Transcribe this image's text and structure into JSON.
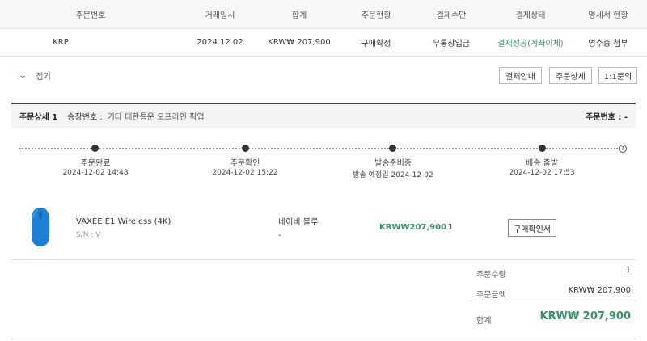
{
  "table": {
    "headers": [
      "주문번호",
      "거래일시",
      "합계",
      "주문현황",
      "결제수단",
      "결제상태",
      "명세서 현황"
    ],
    "row": {
      "order_no": "KRP",
      "date": "2024.12.02",
      "total": "KRW₩ 207,900",
      "status": "구매확정",
      "payment_method": "무통장입금",
      "payment_status": "결제성공(계좌이체)",
      "statement": "영수증 첨부"
    }
  },
  "actions": {
    "fold_label": "접기",
    "payment_guide": "결제안내",
    "order_detail": "주문상세",
    "inquiry": "1:1문의"
  },
  "detail": {
    "title": "주문상세 1",
    "shipping_label": "송장번호 :",
    "shipping_value": "기타 대한통운 오프라인 픽업",
    "order_no_label": "주문번호 : -"
  },
  "timeline": [
    {
      "label": "주문완료",
      "date": "2024-12-02 14:48"
    },
    {
      "label": "주문확인",
      "date": "2024-12-02 15:22"
    },
    {
      "label": "발송준비중",
      "date": "발송 예정일 2024-12-02"
    },
    {
      "label": "배송 출발",
      "date": "2024-12-02 17:53"
    }
  ],
  "product": {
    "name": "VAXEE E1 Wireless (4K)",
    "sn": "S/N : V",
    "option": "네이비 블루",
    "option_sub": "-",
    "price": "KRW₩207,900",
    "qty": "1",
    "confirm_button": "구매확인서"
  },
  "summary": {
    "qty_label": "주문수량",
    "qty_value": "1",
    "amount_label": "주문금액",
    "amount_value": "KRW₩ 207,900",
    "total_label": "합계",
    "total_value": "KRW₩ 207,900"
  },
  "colors": {
    "accent_green": "#3b8f6a",
    "product_blue": "#1e7fd6"
  }
}
